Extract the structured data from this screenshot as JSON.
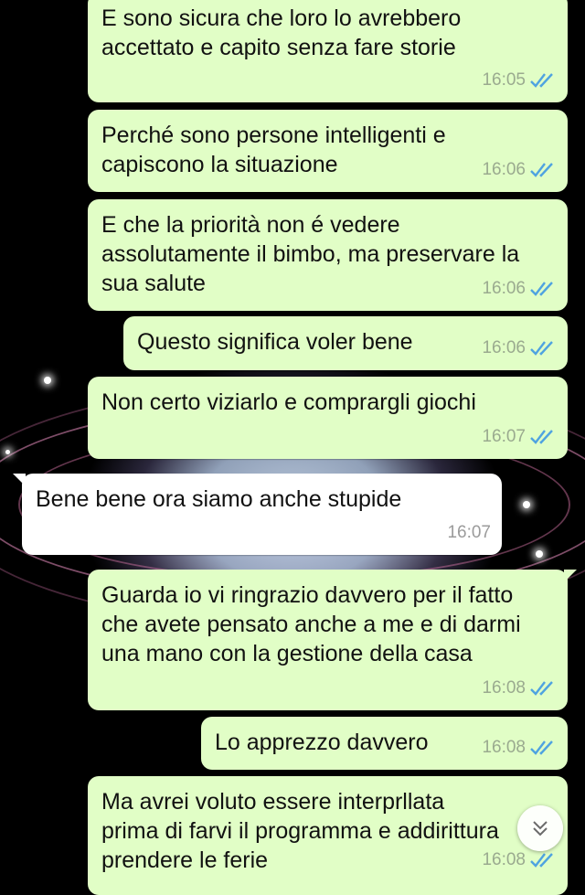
{
  "messages": [
    {
      "direction": "out",
      "text": "E sono sicura che loro lo avrebbero\naccettato e capito senza fare storie",
      "time": "16:05",
      "status_icon": "double-check-icon"
    },
    {
      "direction": "out",
      "text": "Perché sono persone intelligenti e\ncapiscono la situazione",
      "time": "16:06",
      "status_icon": "double-check-icon"
    },
    {
      "direction": "out",
      "text": "E che la priorità non é vedere\nassolutamente il bimbo, ma preservare la\nsua salute",
      "time": "16:06",
      "status_icon": "double-check-icon"
    },
    {
      "direction": "out",
      "text": "Questo significa voler bene",
      "time": "16:06",
      "status_icon": "double-check-icon"
    },
    {
      "direction": "out",
      "text": "Non certo viziarlo e comprargli giochi",
      "time": "16:07",
      "status_icon": "double-check-icon"
    },
    {
      "direction": "in",
      "text": "Bene bene ora siamo anche stupide",
      "time": "16:07"
    },
    {
      "direction": "out",
      "text": "Guarda io vi ringrazio davvero per il fatto\nche avete pensato anche a me e di darmi\nuna mano con la gestione della casa",
      "time": "16:08",
      "status_icon": "double-check-icon"
    },
    {
      "direction": "out",
      "text": "Lo apprezzo davvero",
      "time": "16:08",
      "status_icon": "double-check-icon"
    },
    {
      "direction": "out",
      "text": "Ma avrei voluto essere interprllata\nprima di farvi il programma e addirittura\nprendere le ferie",
      "time": "16:08",
      "status_icon": "double-check-icon"
    }
  ],
  "scroll_button": {
    "icon": "chevron-double-down-icon"
  },
  "colors": {
    "outgoing_bubble": "#e1fec6",
    "incoming_bubble": "#ffffff",
    "read_checks": "#4fa3e0",
    "background": "#000000"
  }
}
